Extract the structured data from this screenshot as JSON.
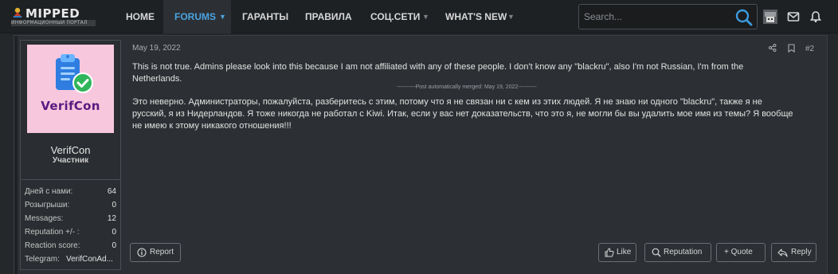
{
  "header": {
    "logo_title": "MIPPED",
    "logo_subtitle": "ИНФОРМАЦИОННЫЙ ПОРТАЛ",
    "nav": [
      {
        "label": "HOME"
      },
      {
        "label": "FORUMS"
      },
      {
        "label": "ГАРАНТЫ"
      },
      {
        "label": "ПРАВИЛА"
      },
      {
        "label": "СОЦ.СЕТИ"
      },
      {
        "label": "WHAT'S NEW"
      }
    ],
    "active_color": "#4aa3df",
    "search": {
      "placeholder": "Search..."
    },
    "icons": [
      "avatar",
      "envelope-icon",
      "bell-icon"
    ]
  },
  "post": {
    "user": {
      "avatar_text": "VerifCon",
      "name": "VerifCon",
      "title": "Участник",
      "stats": [
        {
          "label": "Дней с нами:",
          "value": "64"
        },
        {
          "label": "Розыгрыши:",
          "value": "0"
        },
        {
          "label": "Messages:",
          "value": "12"
        },
        {
          "label": "Reputation +/- :",
          "value": "0"
        },
        {
          "label": "Reaction score:",
          "value": "0"
        },
        {
          "label": "Telegram:",
          "value": "VerifConAd..."
        }
      ]
    },
    "date": "May 19, 2022",
    "number": "#2",
    "text_en_line1": "This is not true. Admins please look into this because I am not affiliated with any of these people. I don't know any \"blackru\", also I'm not Russian, I'm from the",
    "text_en_line2": "Netherlands.",
    "merge_note": "----------Post automatically merged: May 19, 2022----------",
    "text_ru_line1": "Это неверно. Администраторы, пожалуйста, разберитесь с этим, потому что я не связан ни с кем из этих людей. Я не знаю ни одного \"blackru\", также я не",
    "text_ru_line2": "русский, я из Нидерландов. Я тоже никогда не работал с Kiwi. Итак, если у вас нет доказательств, что это я, не могли бы вы удалить мое имя из темы? Я вообще",
    "text_ru_line3": "не имею к этому никакого отношения!!!",
    "buttons": {
      "report": "Report",
      "like": "Like",
      "reputation": "Reputation",
      "quote": "+ Quote",
      "reply": "Reply"
    }
  }
}
